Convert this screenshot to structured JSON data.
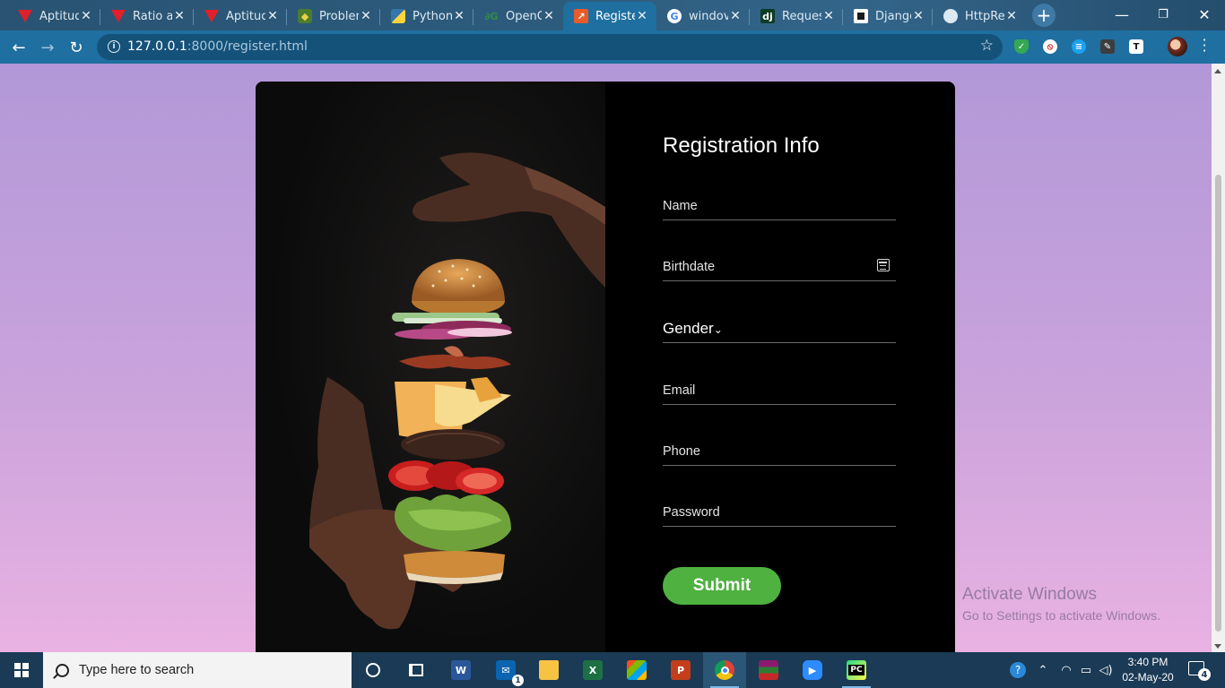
{
  "browser": {
    "tabs": [
      {
        "title": "Aptitud",
        "favicon": "v-icon"
      },
      {
        "title": "Ratio a",
        "favicon": "v-icon"
      },
      {
        "title": "Aptitud",
        "favicon": "v-icon"
      },
      {
        "title": "Probler",
        "favicon": "py-icon"
      },
      {
        "title": "Python",
        "favicon": "python-org-icon"
      },
      {
        "title": "OpenG",
        "favicon": "gfg-icon"
      },
      {
        "title": "Registe",
        "favicon": "registration-icon"
      },
      {
        "title": "windov",
        "favicon": "google-icon"
      },
      {
        "title": "Reques",
        "favicon": "django-icon"
      },
      {
        "title": "Djangc",
        "favicon": "django-docs-icon"
      },
      {
        "title": "HttpRe",
        "favicon": "globe-icon"
      }
    ],
    "active_tab_index": 6,
    "url_host": "127.0.0.1",
    "url_rest": ":8000/register.html",
    "window_controls": [
      "minimize",
      "restore",
      "close"
    ],
    "extensions": [
      "shield-extension",
      "block-extension",
      "chat-extension",
      "pdf-extension",
      "t-extension"
    ]
  },
  "form": {
    "title": "Registration Info",
    "name_placeholder": "Name",
    "birthdate_placeholder": "Birthdate",
    "gender_label": "Gender",
    "email_placeholder": "Email",
    "phone_placeholder": "Phone",
    "password_placeholder": "Password",
    "submit_label": "Submit"
  },
  "watermark": {
    "line1": "Activate Windows",
    "line2": "Go to Settings to activate Windows."
  },
  "taskbar": {
    "search_placeholder": "Type here to search",
    "apps": [
      "cortana-icon",
      "task-view-icon",
      "word-icon",
      "mail-icon",
      "file-explorer-icon",
      "excel-icon",
      "store-icon",
      "powerpoint-icon",
      "chrome-icon",
      "winrar-icon",
      "zoom-icon",
      "pycharm-icon"
    ],
    "mail_badge": "1",
    "time": "3:40 PM",
    "date": "02-May-20",
    "notification_count": "4"
  },
  "colors": {
    "accent": "#1f6fa0",
    "submit": "#4eb140",
    "page_top": "#b298d8",
    "page_bottom": "#e9b2e2"
  }
}
